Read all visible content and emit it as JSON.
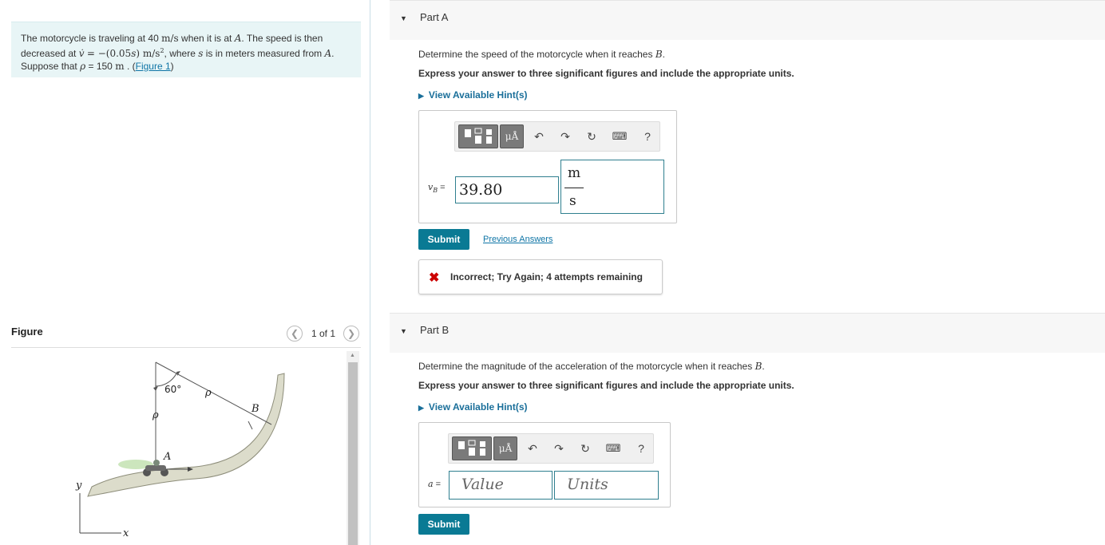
{
  "problem": {
    "text_1": "The motorcycle is traveling at 40",
    "unit_ms": "m/s",
    "text_2": "when it is at",
    "point_a": "A",
    "text_3": ". The speed is then decreased at",
    "vdot": "v̇",
    "eq": "= −(0.05",
    "s_var": "s",
    "eq_close": ") m/s",
    "sq": "2",
    "text_4": ", where",
    "text_5": "is in meters measured from",
    "text_6": ". Suppose that",
    "rho": "ρ",
    "text_7": "= 150",
    "unit_m": "m",
    "text_8": ". (",
    "figure_link": "Figure 1",
    "text_9": ")"
  },
  "figure": {
    "header": "Figure",
    "count": "1 of 1",
    "prev_icon": "chevron-left-icon",
    "next_icon": "chevron-right-icon",
    "labels": {
      "angle": "60°",
      "rho1": "ρ",
      "rho2": "ρ",
      "b": "B",
      "a": "A",
      "y": "y",
      "x": "x"
    }
  },
  "part_a": {
    "title": "Part A",
    "question_1": "Determine the speed of the motorcycle when it reaches",
    "point": "B",
    "question_2": ".",
    "instructions": "Express your answer to three significant figures and include the appropriate units.",
    "hint": "View Available Hint(s)",
    "var_v": "v",
    "var_sub": "B",
    "equals": "=",
    "value": "39.80",
    "unit_num": "m",
    "unit_den": "s",
    "mu_label": "μÅ",
    "help": "?",
    "submit": "Submit",
    "previous_answers": "Previous Answers",
    "feedback": "Incorrect; Try Again; 4 attempts remaining"
  },
  "part_b": {
    "title": "Part B",
    "question_1": "Determine the magnitude of the acceleration of the motorcycle when it reaches",
    "point": "B",
    "question_2": ".",
    "instructions": "Express your answer to three significant figures and include the appropriate units.",
    "hint": "View Available Hint(s)",
    "var_a": "a",
    "equals": "=",
    "value_placeholder": "Value",
    "units_placeholder": "Units",
    "mu_label": "μÅ",
    "help": "?",
    "submit": "Submit"
  },
  "colors": {
    "accent": "#0a7a94",
    "link": "#0f75a6",
    "error": "#cc0000",
    "problem_bg": "#e8f5f6"
  }
}
